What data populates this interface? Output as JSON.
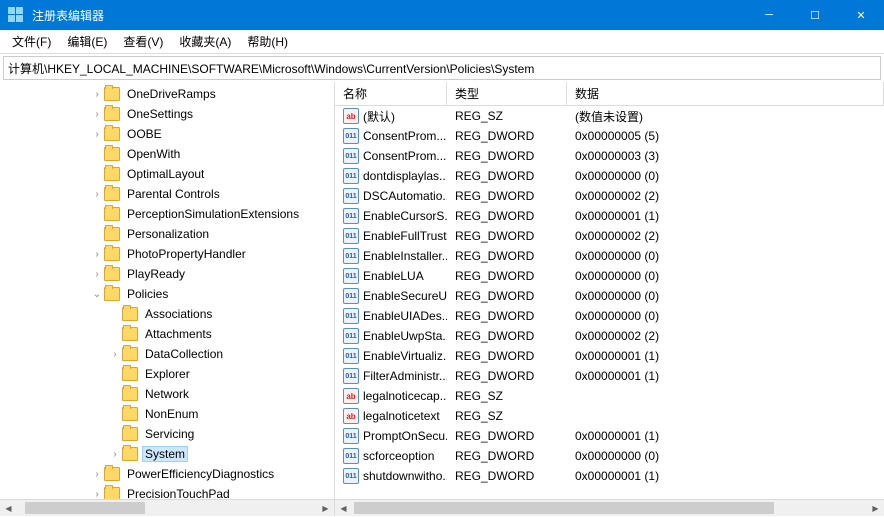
{
  "titlebar": {
    "title": "注册表编辑器"
  },
  "menubar": {
    "file": "文件(F)",
    "edit": "编辑(E)",
    "view": "查看(V)",
    "favorites": "收藏夹(A)",
    "help": "帮助(H)"
  },
  "addressbar": "计算机\\HKEY_LOCAL_MACHINE\\SOFTWARE\\Microsoft\\Windows\\CurrentVersion\\Policies\\System",
  "tree": [
    {
      "indent": 5,
      "exp": ">",
      "label": "OneDriveRamps"
    },
    {
      "indent": 5,
      "exp": ">",
      "label": "OneSettings"
    },
    {
      "indent": 5,
      "exp": ">",
      "label": "OOBE"
    },
    {
      "indent": 5,
      "exp": "",
      "label": "OpenWith"
    },
    {
      "indent": 5,
      "exp": "",
      "label": "OptimalLayout"
    },
    {
      "indent": 5,
      "exp": ">",
      "label": "Parental Controls"
    },
    {
      "indent": 5,
      "exp": "",
      "label": "PerceptionSimulationExtensions"
    },
    {
      "indent": 5,
      "exp": "",
      "label": "Personalization"
    },
    {
      "indent": 5,
      "exp": ">",
      "label": "PhotoPropertyHandler"
    },
    {
      "indent": 5,
      "exp": ">",
      "label": "PlayReady"
    },
    {
      "indent": 5,
      "exp": "v",
      "label": "Policies"
    },
    {
      "indent": 6,
      "exp": "",
      "label": "Associations"
    },
    {
      "indent": 6,
      "exp": "",
      "label": "Attachments"
    },
    {
      "indent": 6,
      "exp": ">",
      "label": "DataCollection"
    },
    {
      "indent": 6,
      "exp": "",
      "label": "Explorer"
    },
    {
      "indent": 6,
      "exp": "",
      "label": "Network"
    },
    {
      "indent": 6,
      "exp": "",
      "label": "NonEnum"
    },
    {
      "indent": 6,
      "exp": "",
      "label": "Servicing"
    },
    {
      "indent": 6,
      "exp": ">",
      "label": "System",
      "selected": true
    },
    {
      "indent": 5,
      "exp": ">",
      "label": "PowerEfficiencyDiagnostics"
    },
    {
      "indent": 5,
      "exp": ">",
      "label": "PrecisionTouchPad"
    }
  ],
  "list": {
    "headers": {
      "name": "名称",
      "type": "类型",
      "data": "数据"
    },
    "rows": [
      {
        "icon": "sz",
        "name": "(默认)",
        "type": "REG_SZ",
        "data": "(数值未设置)"
      },
      {
        "icon": "dw",
        "name": "ConsentProm...",
        "type": "REG_DWORD",
        "data": "0x00000005 (5)"
      },
      {
        "icon": "dw",
        "name": "ConsentProm...",
        "type": "REG_DWORD",
        "data": "0x00000003 (3)"
      },
      {
        "icon": "dw",
        "name": "dontdisplaylas...",
        "type": "REG_DWORD",
        "data": "0x00000000 (0)"
      },
      {
        "icon": "dw",
        "name": "DSCAutomatio...",
        "type": "REG_DWORD",
        "data": "0x00000002 (2)"
      },
      {
        "icon": "dw",
        "name": "EnableCursorS...",
        "type": "REG_DWORD",
        "data": "0x00000001 (1)"
      },
      {
        "icon": "dw",
        "name": "EnableFullTrust...",
        "type": "REG_DWORD",
        "data": "0x00000002 (2)"
      },
      {
        "icon": "dw",
        "name": "EnableInstaller...",
        "type": "REG_DWORD",
        "data": "0x00000000 (0)"
      },
      {
        "icon": "dw",
        "name": "EnableLUA",
        "type": "REG_DWORD",
        "data": "0x00000000 (0)"
      },
      {
        "icon": "dw",
        "name": "EnableSecureU...",
        "type": "REG_DWORD",
        "data": "0x00000000 (0)"
      },
      {
        "icon": "dw",
        "name": "EnableUIADes...",
        "type": "REG_DWORD",
        "data": "0x00000000 (0)"
      },
      {
        "icon": "dw",
        "name": "EnableUwpSta...",
        "type": "REG_DWORD",
        "data": "0x00000002 (2)"
      },
      {
        "icon": "dw",
        "name": "EnableVirtualiz...",
        "type": "REG_DWORD",
        "data": "0x00000001 (1)"
      },
      {
        "icon": "dw",
        "name": "FilterAdministr...",
        "type": "REG_DWORD",
        "data": "0x00000001 (1)"
      },
      {
        "icon": "sz",
        "name": "legalnoticecap...",
        "type": "REG_SZ",
        "data": ""
      },
      {
        "icon": "sz",
        "name": "legalnoticetext",
        "type": "REG_SZ",
        "data": ""
      },
      {
        "icon": "dw",
        "name": "PromptOnSecu...",
        "type": "REG_DWORD",
        "data": "0x00000001 (1)"
      },
      {
        "icon": "dw",
        "name": "scforceoption",
        "type": "REG_DWORD",
        "data": "0x00000000 (0)"
      },
      {
        "icon": "dw",
        "name": "shutdownwitho...",
        "type": "REG_DWORD",
        "data": "0x00000001 (1)"
      }
    ]
  }
}
